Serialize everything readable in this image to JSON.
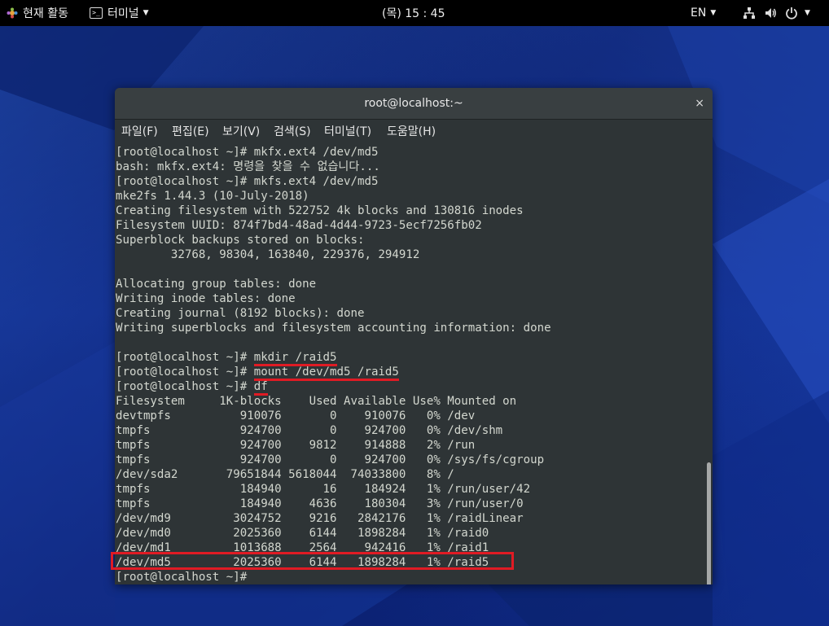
{
  "topbar": {
    "activities": "현재 활동",
    "app_menu": "터미널",
    "clock": "(목) 15 : 45",
    "lang": "EN"
  },
  "window": {
    "title": "root@localhost:~",
    "close_glyph": "×"
  },
  "menu": [
    "파일(F)",
    "편집(E)",
    "보기(V)",
    "검색(S)",
    "터미널(T)",
    "도움말(H)"
  ],
  "terminal": {
    "lines": [
      "[root@localhost ~]# mkfx.ext4 /dev/md5",
      "bash: mkfx.ext4: 명령을 찾을 수 없습니다...",
      "[root@localhost ~]# mkfs.ext4 /dev/md5",
      "mke2fs 1.44.3 (10-July-2018)",
      "Creating filesystem with 522752 4k blocks and 130816 inodes",
      "Filesystem UUID: 874f7bd4-48ad-4d44-9723-5ecf7256fb02",
      "Superblock backups stored on blocks:",
      "        32768, 98304, 163840, 229376, 294912",
      "",
      "Allocating group tables: done",
      "Writing inode tables: done",
      "Creating journal (8192 blocks): done",
      "Writing superblocks and filesystem accounting information: done",
      "",
      "[root@localhost ~]# mkdir /raid5",
      "[root@localhost ~]# mount /dev/md5 /raid5",
      "[root@localhost ~]# df",
      "Filesystem     1K-blocks    Used Available Use% Mounted on",
      "devtmpfs          910076       0    910076   0% /dev",
      "tmpfs             924700       0    924700   0% /dev/shm",
      "tmpfs             924700    9812    914888   2% /run",
      "tmpfs             924700       0    924700   0% /sys/fs/cgroup",
      "/dev/sda2       79651844 5618044  74033800   8% /",
      "tmpfs             184940      16    184924   1% /run/user/42",
      "tmpfs             184940    4636    180304   3% /run/user/0",
      "/dev/md9         3024752    9216   2842176   1% /raidLinear",
      "/dev/md0         2025360    6144   1898284   1% /raid0",
      "/dev/md1         1013688    2564    942416   1% /raid1",
      "/dev/md5         2025360    6144   1898284   1% /raid5",
      "[root@localhost ~]# "
    ],
    "prompt": "[root@localhost ~]# ",
    "cmd_mkdir": "mkdir /raid5",
    "cmd_mount": "mount /dev/md5 /raid5",
    "cmd_df": "df"
  },
  "colors": {
    "terminal_bg": "#2e3436",
    "terminal_fg": "#d3d7cf",
    "highlight": "#e01b24"
  }
}
